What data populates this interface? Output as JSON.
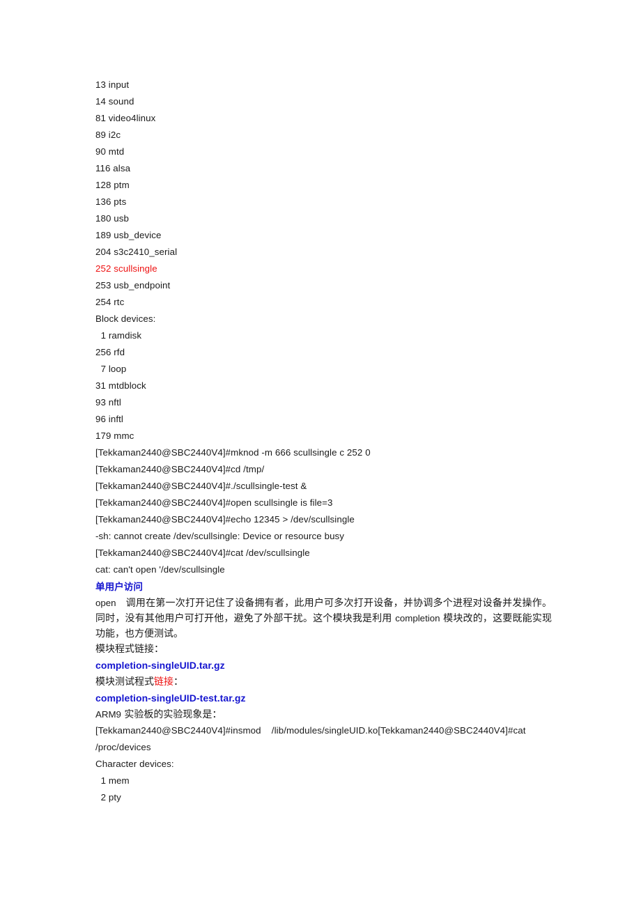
{
  "page": {
    "background": "#ffffff",
    "text_color": "#1a1a1a",
    "accent_red": "#ee1111",
    "accent_blue": "#1515cf"
  },
  "device_list": {
    "char_entries": [
      "13 input",
      "14 sound",
      "81 video4linux",
      "89 i2c",
      "90 mtd",
      "116 alsa",
      "128 ptm",
      "136 pts",
      "180 usb",
      "189 usb_device",
      "204 s3c2410_serial"
    ],
    "highlighted_entry": "252 scullsingle",
    "char_entries_after": [
      "253 usb_endpoint",
      "254 rtc"
    ],
    "block_header": "Block devices:",
    "block_entries": [
      "  1 ramdisk",
      "256 rfd",
      "  7 loop",
      "31 mtdblock",
      "93 nftl",
      "96 inftl",
      "179 mmc"
    ]
  },
  "console_session": {
    "lines": [
      "[Tekkaman2440@SBC2440V4]#mknod -m 666 scullsingle c 252 0",
      "[Tekkaman2440@SBC2440V4]#cd /tmp/",
      "[Tekkaman2440@SBC2440V4]#./scullsingle-test &",
      "[Tekkaman2440@SBC2440V4]#open scullsingle is file=3",
      "[Tekkaman2440@SBC2440V4]#echo 12345 > /dev/scullsingle",
      "-sh: cannot create /dev/scullsingle: Device or resource busy",
      "[Tekkaman2440@SBC2440V4]#cat /dev/scullsingle",
      "cat: can't open '/dev/scullsingle"
    ]
  },
  "section": {
    "heading": "单用户访问",
    "paragraph_latin_lead": "open",
    "paragraph_text": "调用在第一次打开记住了设备拥有者，此用户可多次打开设备，并协调多个进程对设备并发操作。同时，没有其他用户可打开他，避免了外部干扰。这个模块我是利用 ",
    "paragraph_inline_latin": "completion",
    "paragraph_text_tail": " 模块改的，这要既能实现功能，也方便测试。",
    "module_link_label": "模块程式链接：",
    "module_link": "completion-singleUID.tar.gz",
    "test_link_label_prefix": "模块测试程式",
    "test_link_label_red": "链接",
    "test_link_label_suffix": "：",
    "test_link": "completion-singleUID-test.tar.gz",
    "arm_intro_latin": "ARM9",
    "arm_intro_text": " 实验板的实验现象是："
  },
  "console_session_2": {
    "lines": [
      "[Tekkaman2440@SBC2440V4]#insmod    /lib/modules/singleUID.ko[Tekkaman2440@SBC2440V4]#cat",
      "/proc/devices",
      "Character devices:",
      "  1 mem",
      "  2 pty"
    ]
  }
}
